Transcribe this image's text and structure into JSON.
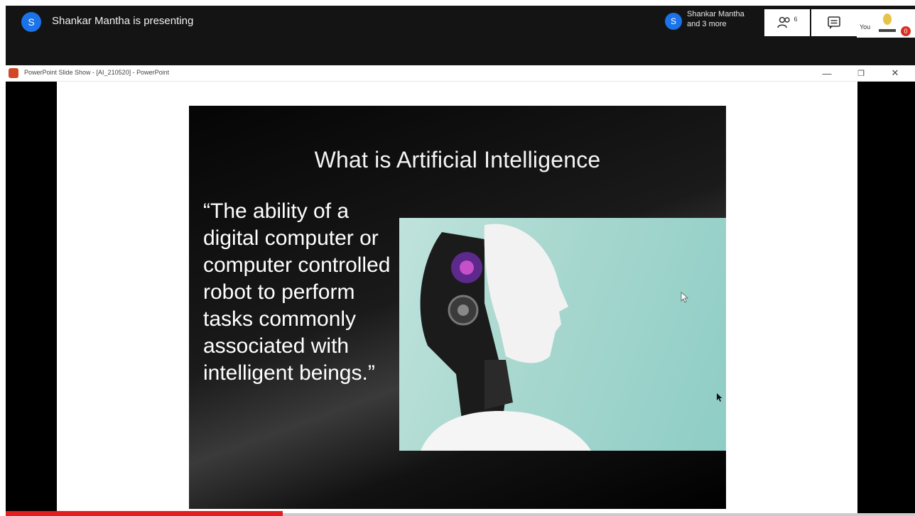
{
  "meet": {
    "presenter_initial": "S",
    "presenting_text": "Shankar Mantha is presenting",
    "participant_initial": "S",
    "participant_line1": "Shankar Mantha",
    "participant_line2": "and 3 more",
    "people_count": "6",
    "you_label": "You",
    "notification_count": "0"
  },
  "window": {
    "title": "PowerPoint Slide Show - [AI_210520] - PowerPoint",
    "minimize": "—",
    "restore": "❐",
    "close": "✕"
  },
  "slide": {
    "title": "What is Artificial Intelligence",
    "quote": "“The ability of a digital computer or computer controlled robot to perform tasks commonly associated with intelligent beings.”"
  },
  "colors": {
    "meet_bar": "#141414",
    "avatar": "#1a73e8",
    "ppt_icon": "#d24726",
    "progress": "#e31e1e"
  },
  "icons": [
    "people-icon",
    "chat-icon",
    "self-view-icon",
    "cursor-icon"
  ]
}
